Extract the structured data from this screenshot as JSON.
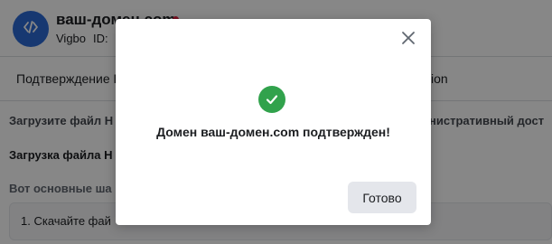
{
  "colors": {
    "brand_blue": "#2d6bd6",
    "status_red": "#e41e3f",
    "success_green": "#31a24c",
    "overlay": "rgba(0,0,0,0.47)"
  },
  "header": {
    "avatar_icon": "code-icon",
    "domain_title": "ваш-домен.com",
    "status_icon": "status-dot-red",
    "business_name": "Vigbo",
    "id_label": "ID:"
  },
  "tabs": [
    {
      "label": "Подтверждение Г"
    },
    {
      "label": "ion"
    }
  ],
  "content": {
    "para_1": "Загрузите файл Н",
    "para_1_tail": "нистративный дост",
    "para_2": "Загрузка файла Н",
    "para_3": "Вот основные ша",
    "step_1": "1. Скачайте фай"
  },
  "modal": {
    "close_icon": "close-icon",
    "success_icon": "check-circle-icon",
    "message": "Домен ваш-домен.com подтвержден!",
    "done_label": "Готово"
  }
}
